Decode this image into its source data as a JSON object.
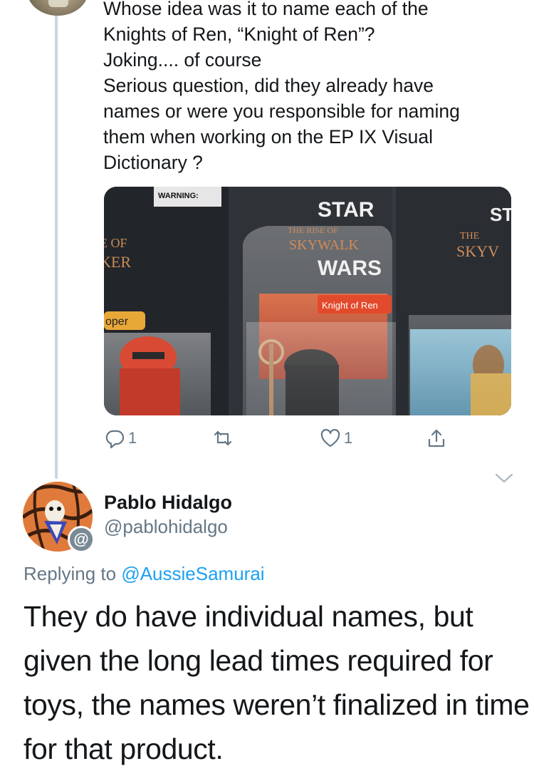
{
  "parent_tweet": {
    "lines": [
      "Whose idea was it to name each of the",
      "Knights of Ren, “Knight of Ren”?",
      "Joking.... of course",
      "Serious question, did they already have",
      "names or were you responsible for naming",
      "them when working on the EP IX Visual",
      "Dictionary ?"
    ],
    "media": {
      "warning_label": "WARNING:",
      "logo_star": "STAR",
      "logo_wars": "WARS",
      "logo_sub": "SKYWALK",
      "logo_the": "THE RISE OF",
      "tag": "Knight of Ren",
      "left_tag": "oper",
      "left_logo_1": "E OF",
      "left_logo_2": "KER",
      "right_logo_1": "THE",
      "right_logo_2": "SKYV",
      "right_logo_3": "ST"
    },
    "actions": {
      "reply_count": "1",
      "retweet_count": "",
      "like_count": "1"
    },
    "icons": [
      "reply-icon",
      "retweet-icon",
      "like-icon",
      "share-icon",
      "chevron-down-icon"
    ],
    "colors": {
      "icon": "#657786",
      "thread_line": "#ccd6dd"
    }
  },
  "reply_tweet": {
    "name": "Pablo Hidalgo",
    "handle": "@pablohidalgo",
    "replying_prefix": "Replying to",
    "replying_to": "@AussieSamurai",
    "lines": [
      "They do have individual names, but",
      "given the long lead times required for",
      "toys, the names weren’t finalized in time",
      "for that product."
    ],
    "badge": "@",
    "colors": {
      "mention": "#1da1f2",
      "secondary": "#657786"
    }
  }
}
